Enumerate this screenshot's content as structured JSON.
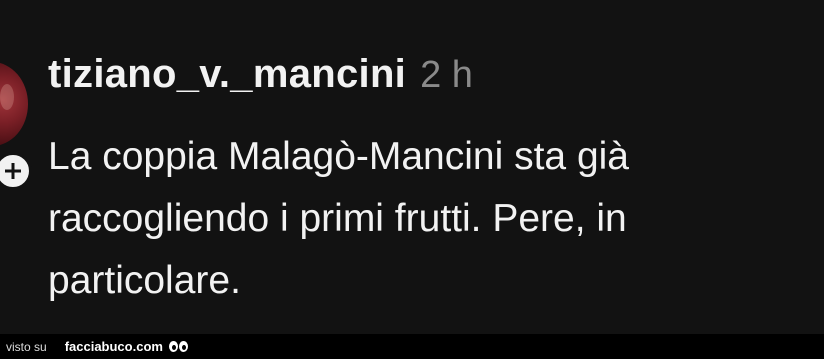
{
  "comment": {
    "username": "tiziano_v._mancini",
    "timestamp": "2 h",
    "text_line_1": "La coppia Malagò-Mancini sta già",
    "text_line_2": "raccogliendo i primi frutti. Pere, in",
    "text_line_3": "particolare."
  },
  "footer": {
    "visto_label": "visto su",
    "site_name": "facciabuco.com"
  },
  "icons": {
    "avatar": "user-avatar",
    "add": "plus-icon",
    "logo": "eyes-icon"
  },
  "colors": {
    "background": "#121212",
    "text": "#f2f2f2",
    "timestamp": "#8a8a8a",
    "footer_bg": "#000000"
  }
}
